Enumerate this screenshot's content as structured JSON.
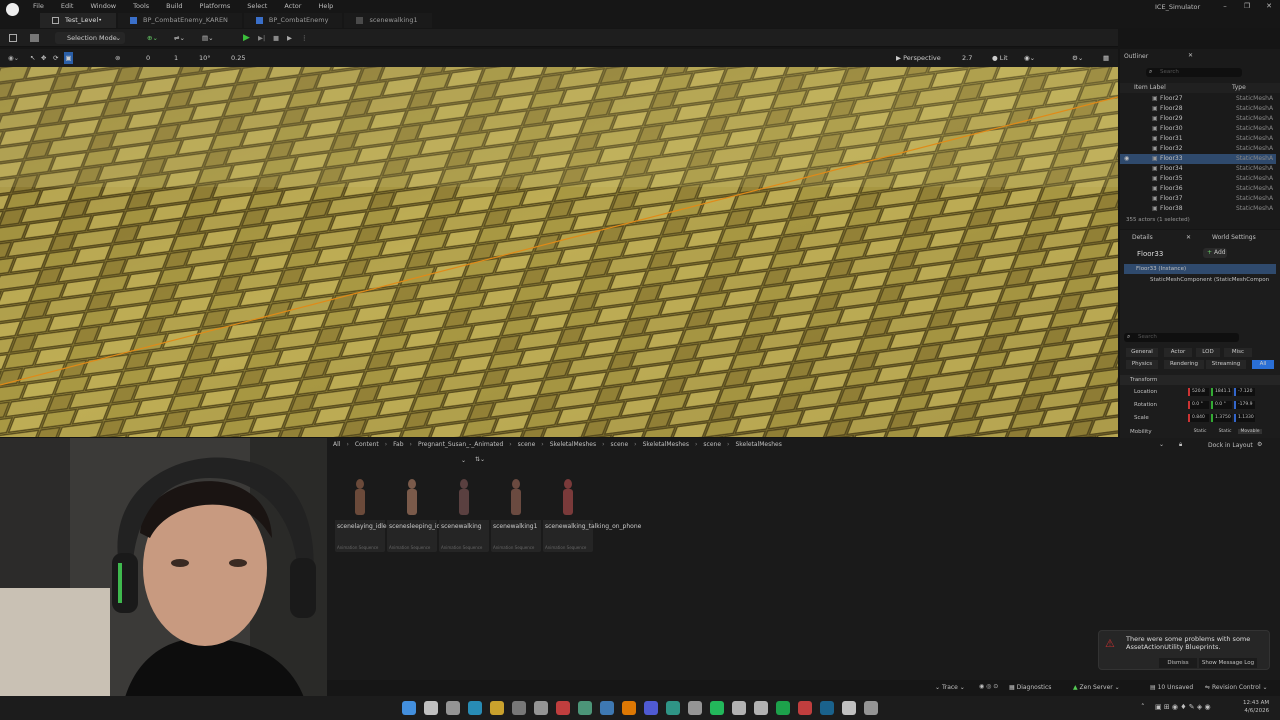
{
  "app": {
    "title": "ICE_Simulator"
  },
  "menu": [
    "File",
    "Edit",
    "Window",
    "Tools",
    "Build",
    "Platforms",
    "Select",
    "Actor",
    "Help"
  ],
  "tabs": [
    {
      "label": "Test_Level•"
    },
    {
      "label": "BP_CombatEnemy_KAREN"
    },
    {
      "label": "BP_CombatEnemy"
    },
    {
      "label": "scenewalking1"
    }
  ],
  "toolbar": {
    "mode": "Selection Mode"
  },
  "viewport_toolbar": {
    "snap_angle": "10°",
    "snap_scale": "0.25",
    "perspective": "Perspective",
    "cam_speed": "2.7",
    "lit": "Lit",
    "angle_zero": "0",
    "grid_one": "1"
  },
  "outliner": {
    "title": "Outliner",
    "search_placeholder": "Search",
    "col_label": "Item Label",
    "col_type": "Type",
    "items": [
      {
        "name": "Floor27",
        "type": "StaticMeshA"
      },
      {
        "name": "Floor28",
        "type": "StaticMeshA"
      },
      {
        "name": "Floor29",
        "type": "StaticMeshA"
      },
      {
        "name": "Floor30",
        "type": "StaticMeshA"
      },
      {
        "name": "Floor31",
        "type": "StaticMeshA"
      },
      {
        "name": "Floor32",
        "type": "StaticMeshA"
      },
      {
        "name": "Floor33",
        "type": "StaticMeshA"
      },
      {
        "name": "Floor34",
        "type": "StaticMeshA"
      },
      {
        "name": "Floor35",
        "type": "StaticMeshA"
      },
      {
        "name": "Floor36",
        "type": "StaticMeshA"
      },
      {
        "name": "Floor37",
        "type": "StaticMeshA"
      },
      {
        "name": "Floor38",
        "type": "StaticMeshA"
      }
    ],
    "status": "355 actors (1 selected)"
  },
  "details": {
    "tab_details": "Details",
    "tab_world": "World Settings",
    "object_name": "Floor33",
    "add": "Add",
    "instance": "Floor33 (Instance)",
    "component": "StaticMeshComponent (StaticMeshCompon",
    "search_placeholder": "Search",
    "filters": [
      "General",
      "Actor",
      "LOD",
      "Misc",
      "Physics",
      "Rendering",
      "Streaming",
      "All"
    ],
    "section": "Transform",
    "location_label": "Location",
    "rotation_label": "Rotation",
    "scale_label": "Scale",
    "mobility_label": "Mobility",
    "location": [
      "520.8",
      "1841.1",
      "-7.120"
    ],
    "rotation": [
      "0.0 °",
      "0.0 °",
      "-179.9"
    ],
    "scale": [
      "0.840",
      "1.3750",
      "1.1330"
    ],
    "mobility": [
      "Static",
      "Static",
      "Movable"
    ]
  },
  "content": {
    "breadcrumb": [
      "All",
      "Content",
      "Fab",
      "Pregnant_Susan_-_Animated",
      "scene",
      "SkeletalMeshes",
      "scene",
      "SkeletalMeshes",
      "scene",
      "SkeletalMeshes"
    ],
    "dock": "Dock in Layout",
    "assets": [
      {
        "name": "scenelaying_idle",
        "type": "Animation Sequence"
      },
      {
        "name": "scenesleeping_idle",
        "type": "Animation Sequence"
      },
      {
        "name": "scenewalking",
        "type": "Animation Sequence"
      },
      {
        "name": "scenewalking1",
        "type": "Animation Sequence"
      },
      {
        "name": "scenewalking_talking_on_phone",
        "type": "Animation Sequence"
      }
    ]
  },
  "notification": {
    "text": "There were some problems with some AssetActionUtility Blueprints.",
    "dismiss": "Dismiss",
    "show_log": "Show Message Log"
  },
  "statusbar": {
    "trace": "Trace",
    "diagnostics": "Diagnostics",
    "zen": "Zen Server",
    "unsaved": "10 Unsaved",
    "revision": "Revision Control"
  },
  "clock": {
    "time": "12:43 AM",
    "date": "4/6/2026"
  }
}
